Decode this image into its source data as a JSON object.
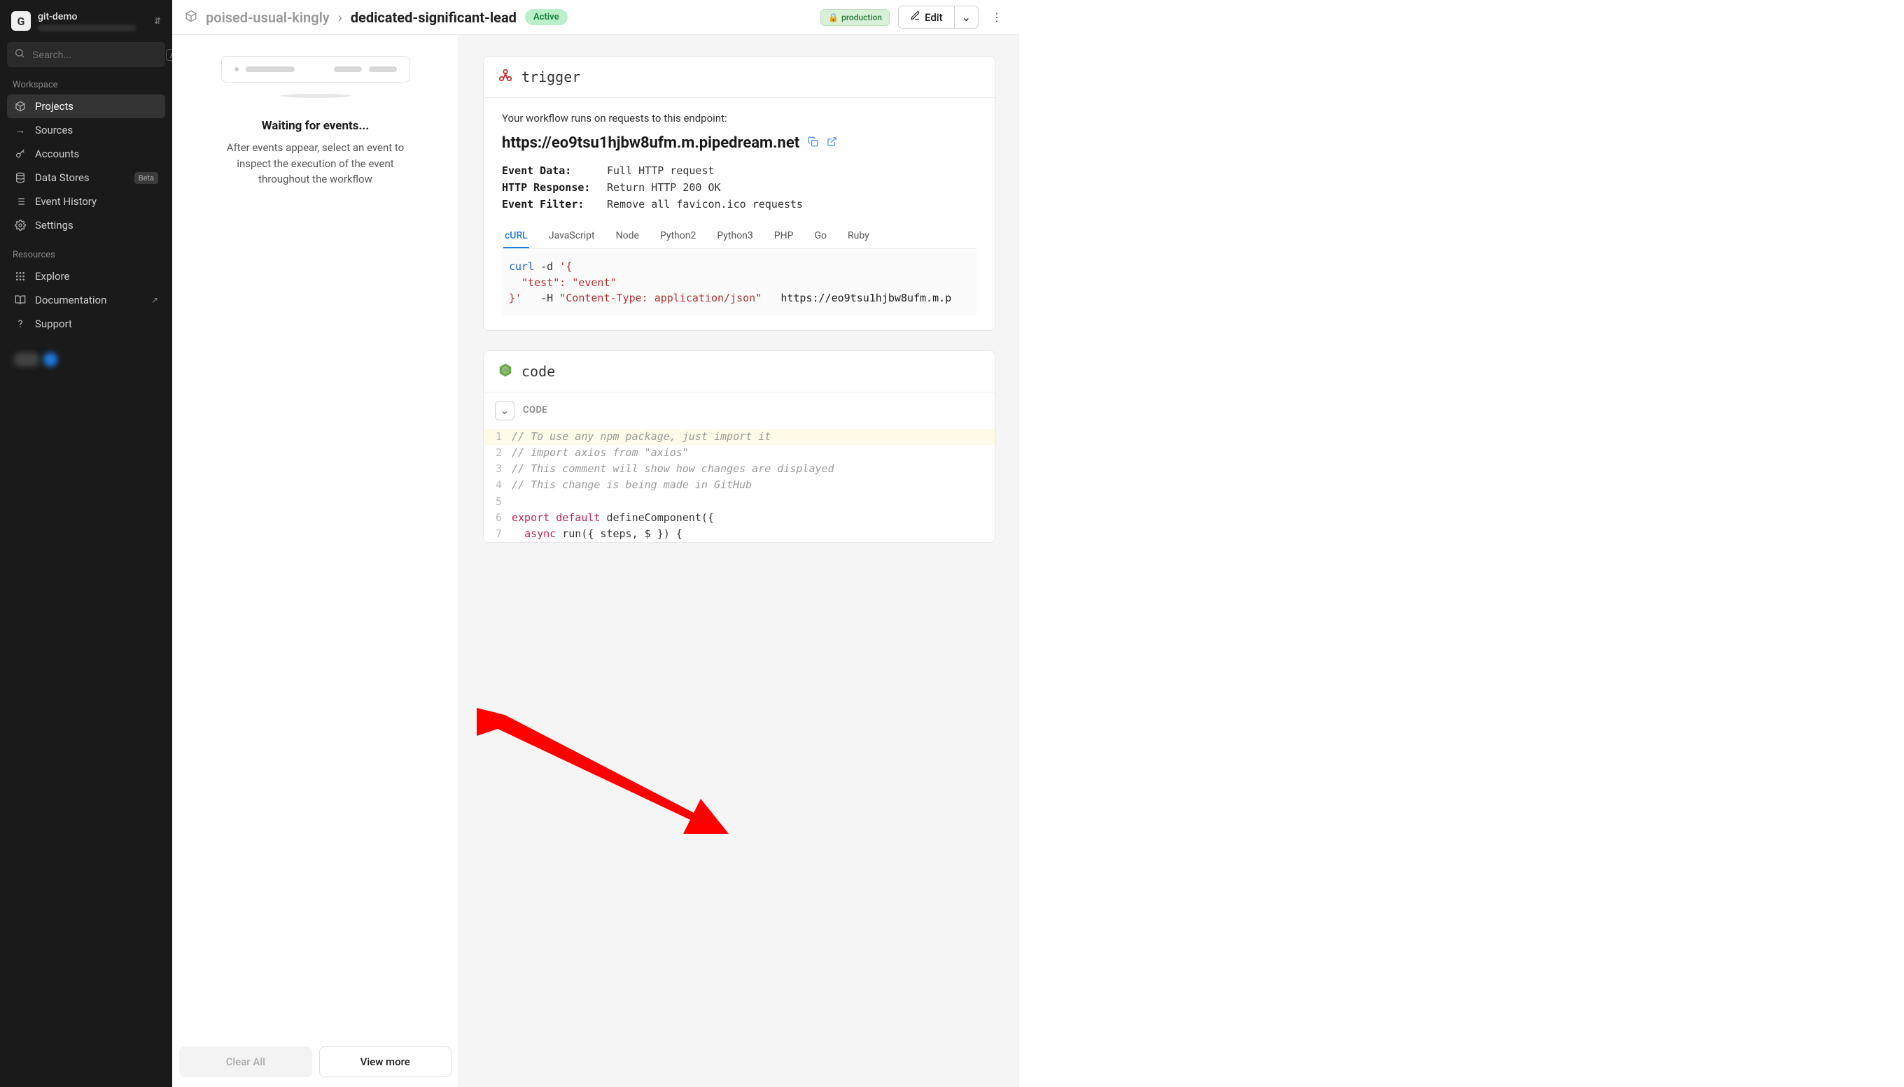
{
  "org": {
    "avatar_letter": "G",
    "name": "git-demo"
  },
  "search": {
    "placeholder": "Search...",
    "shortcut": "/"
  },
  "sidebar": {
    "section_workspace": "Workspace",
    "section_resources": "Resources",
    "items": {
      "projects": "Projects",
      "sources": "Sources",
      "accounts": "Accounts",
      "data_stores": "Data Stores",
      "data_stores_badge": "Beta",
      "event_history": "Event History",
      "settings": "Settings",
      "explore": "Explore",
      "documentation": "Documentation",
      "support": "Support"
    }
  },
  "breadcrumb": {
    "parent": "poised-usual-kingly",
    "current": "dedicated-significant-lead"
  },
  "status": "Active",
  "env_badge": "production",
  "edit_button": "Edit",
  "left_panel": {
    "title": "Waiting for events...",
    "text": "After events appear, select an event to inspect the execution of the event throughout the workflow",
    "clear_all": "Clear All",
    "view_more": "View more"
  },
  "trigger": {
    "title": "trigger",
    "desc": "Your workflow runs on requests to this endpoint:",
    "url": "https://eo9tsu1hjbw8ufm.m.pipedream.net",
    "kv": [
      {
        "k": "Event Data:",
        "v": "Full HTTP request"
      },
      {
        "k": "HTTP Response:",
        "v": "Return HTTP 200 OK"
      },
      {
        "k": "Event Filter:",
        "v": "Remove all favicon.ico requests"
      }
    ],
    "tabs": [
      "cURL",
      "JavaScript",
      "Node",
      "Python2",
      "Python3",
      "PHP",
      "Go",
      "Ruby"
    ],
    "code": {
      "cmd": "curl",
      "flag_d": "-d",
      "payload_open": "'{",
      "payload_body": "  \"test\": \"event\"",
      "payload_close": "}'",
      "flag_h": "-H",
      "header_val": "\"Content-Type: application/json\"",
      "url_tail": "https://eo9tsu1hjbw8ufm.m.p"
    }
  },
  "code_step": {
    "title": "code",
    "label": "CODE",
    "lines": [
      {
        "n": 1,
        "t": "// To use any npm package, just import it",
        "c": "comment",
        "hl": true
      },
      {
        "n": 2,
        "t": "// import axios from \"axios\"",
        "c": "comment"
      },
      {
        "n": 3,
        "t": "// This comment will show how changes are displayed",
        "c": "comment"
      },
      {
        "n": 4,
        "t": "// This change is being made in GitHub",
        "c": "comment"
      },
      {
        "n": 5,
        "t": "",
        "c": "plain"
      },
      {
        "n": 6,
        "t": "export default defineComponent({",
        "c": "export"
      },
      {
        "n": 7,
        "t": "  async run({ steps, $ }) {",
        "c": "async"
      }
    ]
  }
}
